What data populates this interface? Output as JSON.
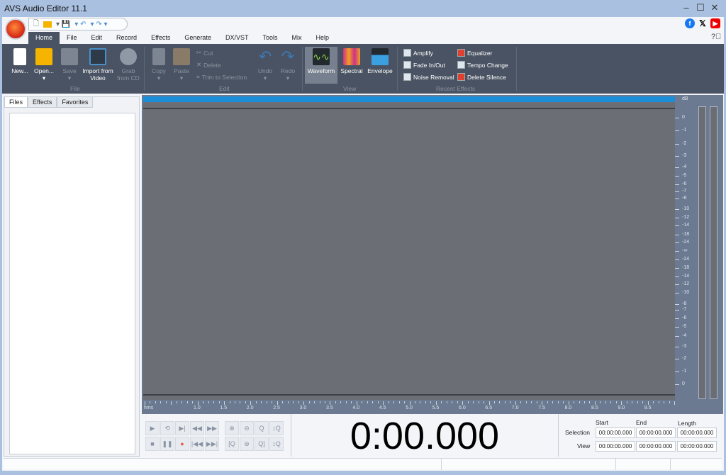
{
  "window": {
    "title": "AVS Audio Editor 11.1"
  },
  "menu": [
    "Home",
    "File",
    "Edit",
    "Record",
    "Effects",
    "Generate",
    "DX/VST",
    "Tools",
    "Mix",
    "Help"
  ],
  "ribbon": {
    "file": {
      "new": "New...",
      "open": "Open...",
      "save": "Save",
      "import": "Import from Video",
      "grab": "Grab from CD",
      "group": "File"
    },
    "edit": {
      "copy": "Copy",
      "paste": "Paste",
      "cut": "Cut",
      "delete": "Delete",
      "trim": "Trim to Selection",
      "undo": "Undo",
      "redo": "Redo",
      "group": "Edit"
    },
    "view": {
      "waveform": "Waveform",
      "spectral": "Spectral",
      "envelope": "Envelope",
      "group": "View"
    },
    "recent": {
      "items": [
        "Amplify",
        "Fade In/Out",
        "Noise Removal",
        "Equalizer",
        "Tempo Change",
        "Delete Silence"
      ],
      "group": "Recent Effects"
    }
  },
  "left_tabs": [
    "Files",
    "Effects",
    "Favorites"
  ],
  "db_scale": {
    "unit": "dB",
    "labels": [
      "0",
      "-1",
      "-2",
      "-3",
      "-4",
      "-5",
      "-6",
      "-7",
      "-8",
      "-10",
      "-12",
      "-14",
      "-18",
      "-24",
      "-∞",
      "-24",
      "-18",
      "-14",
      "-12",
      "-10",
      "-8",
      "-7",
      "-6",
      "-5",
      "-4",
      "-3",
      "-2",
      "-1",
      "0"
    ]
  },
  "ruler": {
    "unit": "hms",
    "labels": [
      "1.0",
      "1.5",
      "2.0",
      "2.5",
      "3.0",
      "3.5",
      "4.0",
      "4.5",
      "5.0",
      "5.5",
      "6.0",
      "6.5",
      "7.0",
      "7.5",
      "8.0",
      "8.5",
      "9.0",
      "9.5"
    ]
  },
  "timer": "0:00.000",
  "selection_panel": {
    "headers": [
      "Start",
      "End",
      "Length"
    ],
    "rows": [
      {
        "label": "Selection",
        "values": [
          "00:00:00.000",
          "00:00:00.000",
          "00:00:00.000"
        ]
      },
      {
        "label": "View",
        "values": [
          "00:00:00.000",
          "00:00:00.000",
          "00:00:00.000"
        ]
      }
    ]
  },
  "colors": {
    "ribbon": "#4a5363",
    "accent": "#1a8ed8",
    "wave_bg": "#6b6e75"
  }
}
